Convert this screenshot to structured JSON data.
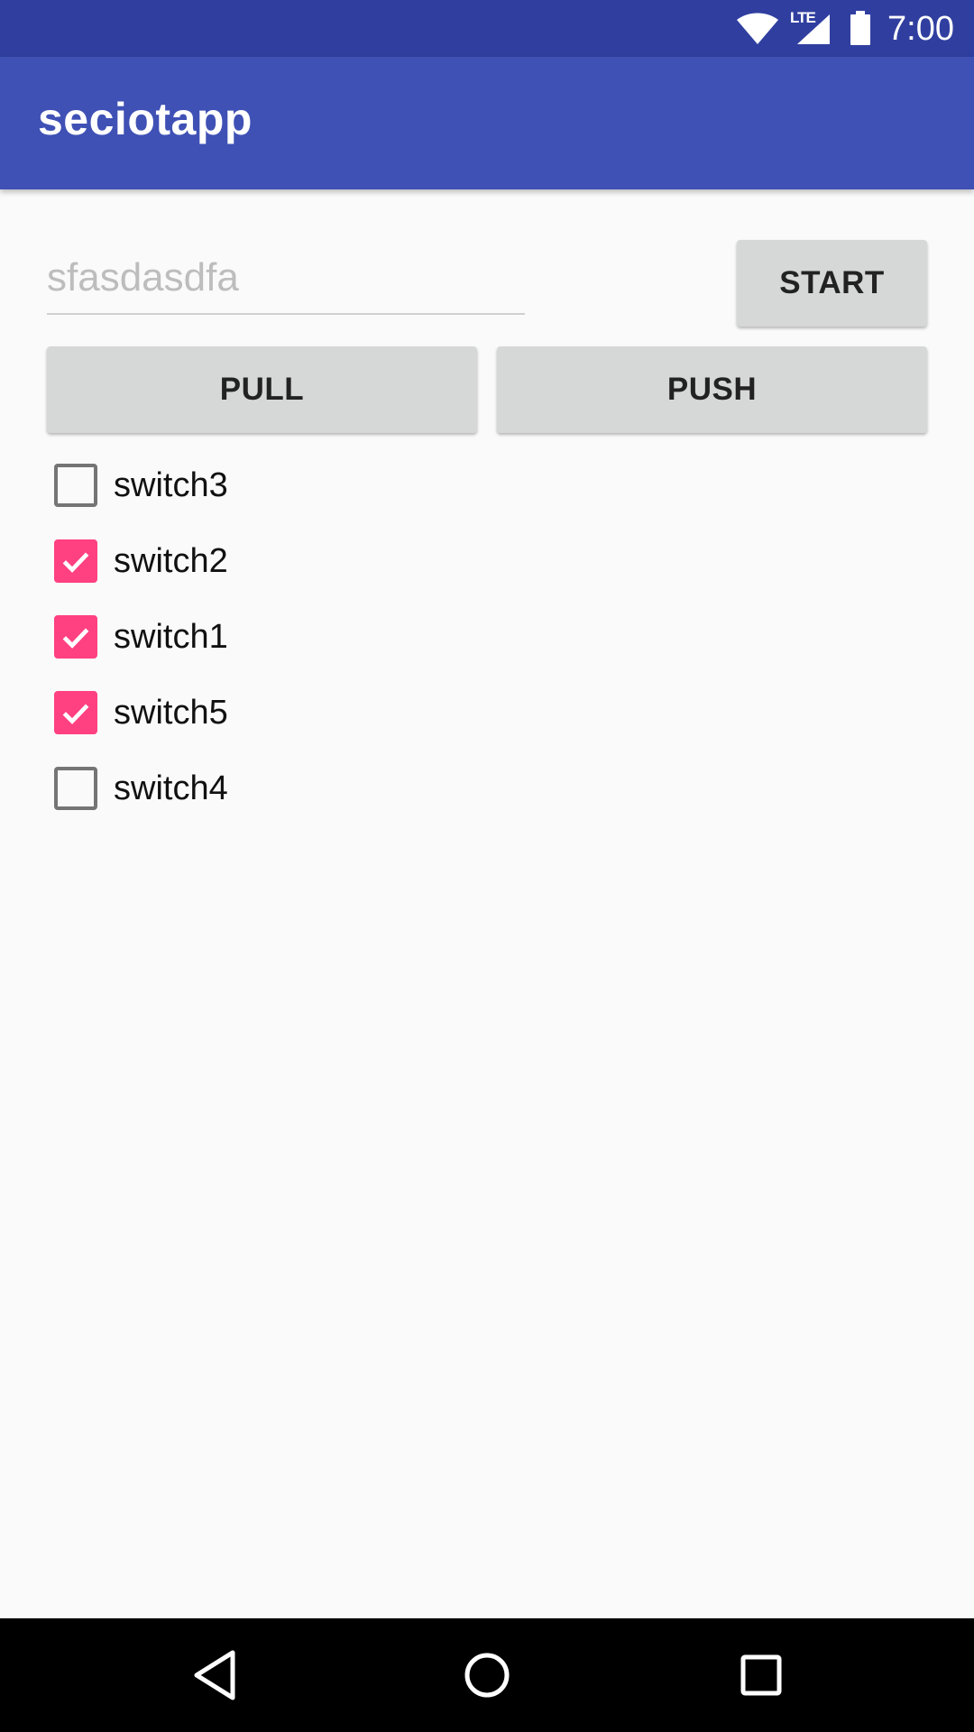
{
  "status_bar": {
    "network_label": "LTE",
    "time": "7:00",
    "icons": [
      "wifi-icon",
      "signal-icon",
      "battery-icon"
    ]
  },
  "app_bar": {
    "title": "seciotapp"
  },
  "main": {
    "text_input": {
      "value": "",
      "placeholder": "sfasdasdfa"
    },
    "buttons": {
      "start_label": "START",
      "pull_label": "PULL",
      "push_label": "PUSH"
    },
    "switches": [
      {
        "label": "switch3",
        "checked": false
      },
      {
        "label": "switch2",
        "checked": true
      },
      {
        "label": "switch1",
        "checked": true
      },
      {
        "label": "switch5",
        "checked": true
      },
      {
        "label": "switch4",
        "checked": false
      }
    ]
  },
  "nav_bar": {
    "icons": [
      "back-icon",
      "home-icon",
      "recents-icon"
    ]
  },
  "colors": {
    "status_bar": "#303f9f",
    "app_bar": "#3f51b5",
    "accent": "#ff4081",
    "button": "#d6d7d7",
    "background": "#fafafa"
  }
}
